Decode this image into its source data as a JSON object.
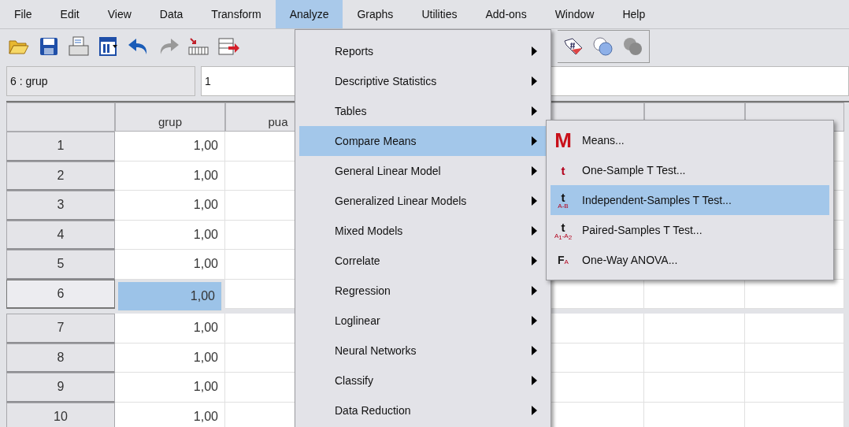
{
  "menubar": [
    {
      "label": "File",
      "selected": false
    },
    {
      "label": "Edit",
      "selected": false
    },
    {
      "label": "View",
      "selected": false
    },
    {
      "label": "Data",
      "selected": false
    },
    {
      "label": "Transform",
      "selected": false
    },
    {
      "label": "Analyze",
      "selected": true
    },
    {
      "label": "Graphs",
      "selected": false
    },
    {
      "label": "Utilities",
      "selected": false
    },
    {
      "label": "Add-ons",
      "selected": false
    },
    {
      "label": "Window",
      "selected": false
    },
    {
      "label": "Help",
      "selected": false
    }
  ],
  "cell_editor": {
    "cell_name": "6 : grup",
    "value": "1"
  },
  "data_grid": {
    "columns": [
      "grup",
      "pua"
    ],
    "rows": [
      {
        "row_number": "1",
        "grup": "1,00",
        "selected": false
      },
      {
        "row_number": "2",
        "grup": "1,00",
        "selected": false
      },
      {
        "row_number": "3",
        "grup": "1,00",
        "selected": false
      },
      {
        "row_number": "4",
        "grup": "1,00",
        "selected": false
      },
      {
        "row_number": "5",
        "grup": "1,00",
        "selected": false
      },
      {
        "row_number": "6",
        "grup": "1,00",
        "selected": true
      },
      {
        "row_number": "7",
        "grup": "1,00",
        "selected": false
      },
      {
        "row_number": "8",
        "grup": "1,00",
        "selected": false
      },
      {
        "row_number": "9",
        "grup": "1,00",
        "selected": false
      },
      {
        "row_number": "10",
        "grup": "1,00",
        "selected": false
      }
    ]
  },
  "analyze_menu": {
    "items": [
      {
        "label": "Reports",
        "selected": false,
        "has_submenu": true
      },
      {
        "label": "Descriptive Statistics",
        "selected": false,
        "has_submenu": true
      },
      {
        "label": "Tables",
        "selected": false,
        "has_submenu": true
      },
      {
        "label": "Compare Means",
        "selected": true,
        "has_submenu": true
      },
      {
        "label": "General Linear Model",
        "selected": false,
        "has_submenu": true
      },
      {
        "label": "Generalized Linear Models",
        "selected": false,
        "has_submenu": true
      },
      {
        "label": "Mixed Models",
        "selected": false,
        "has_submenu": true
      },
      {
        "label": "Correlate",
        "selected": false,
        "has_submenu": true
      },
      {
        "label": "Regression",
        "selected": false,
        "has_submenu": true
      },
      {
        "label": "Loglinear",
        "selected": false,
        "has_submenu": true
      },
      {
        "label": "Neural Networks",
        "selected": false,
        "has_submenu": true
      },
      {
        "label": "Classify",
        "selected": false,
        "has_submenu": true
      },
      {
        "label": "Data Reduction",
        "selected": false,
        "has_submenu": true
      }
    ]
  },
  "compare_means_submenu": {
    "items": [
      {
        "label": "Means...",
        "kind": "means",
        "glyph": "M",
        "selected": false
      },
      {
        "label": "One-Sample T Test...",
        "kind": "t-test",
        "glyph": "t",
        "selected": false
      },
      {
        "label": "Independent-Samples T Test...",
        "kind": "t-test",
        "glyph": "t",
        "sub": "A-B",
        "selected": true
      },
      {
        "label": "Paired-Samples T Test...",
        "kind": "t-test",
        "glyph": "t",
        "sub": "A$_{1}$-A$_{2}$",
        "selected": false
      },
      {
        "label": "One-Way ANOVA...",
        "kind": "anova",
        "glyph": "F",
        "sub": "A",
        "selected": false
      }
    ]
  }
}
